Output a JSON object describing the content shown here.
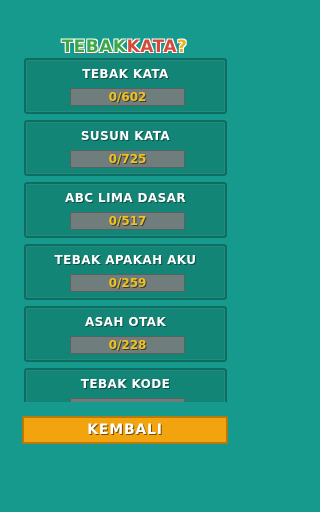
{
  "header": {
    "title_parts": [
      "TEBAK",
      "KATA",
      "?"
    ]
  },
  "categories": [
    {
      "title": "TEBAK KATA",
      "progress_text": "0/602",
      "solved": 0,
      "total": 602
    },
    {
      "title": "SUSUN KATA",
      "progress_text": "0/725",
      "solved": 0,
      "total": 725
    },
    {
      "title": "ABC LIMA DASAR",
      "progress_text": "0/517",
      "solved": 0,
      "total": 517
    },
    {
      "title": "TEBAK APAKAH AKU",
      "progress_text": "0/259",
      "solved": 0,
      "total": 259
    },
    {
      "title": "ASAH OTAK",
      "progress_text": "0/228",
      "solved": 0,
      "total": 228
    },
    {
      "title": "TEBAK KODE",
      "progress_text": "",
      "solved": 0,
      "total": null
    }
  ],
  "footer": {
    "back_label": "KEMBALI"
  },
  "colors": {
    "background": "#169a8d",
    "card": "#138576",
    "progress_track": "#6f7e7c",
    "progress_fill": "#e2a40b",
    "progress_text": "#f2c11a",
    "button": "#f2a40f"
  }
}
